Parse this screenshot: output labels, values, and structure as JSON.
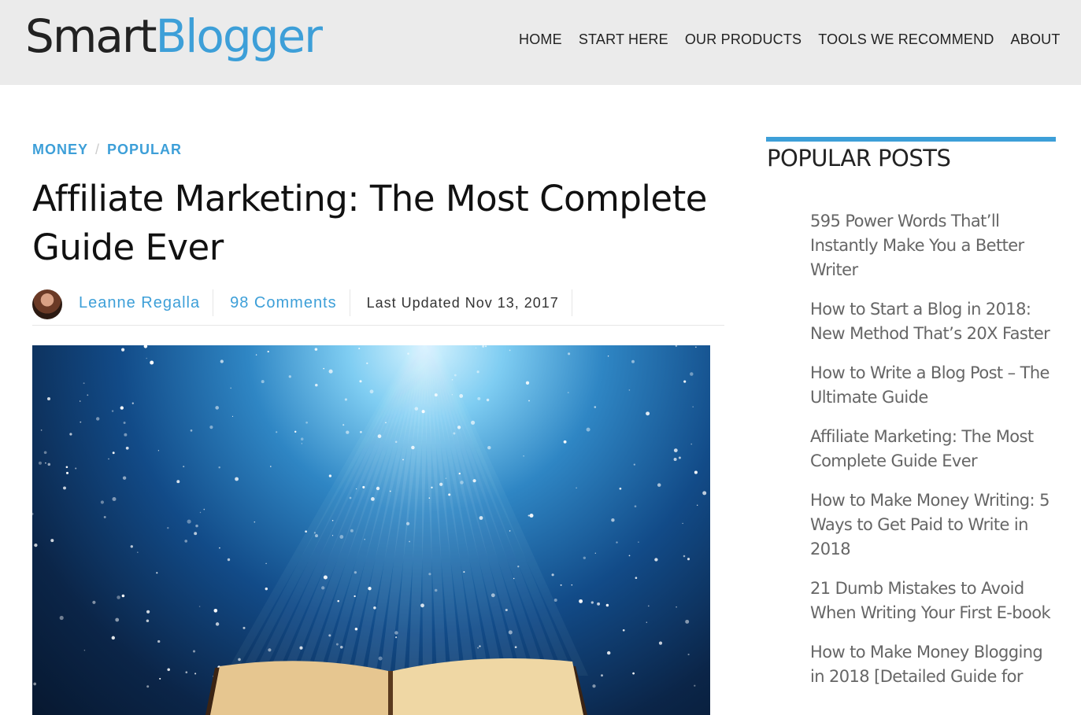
{
  "header": {
    "logo_part1": "Smart",
    "logo_part2": "Blogger",
    "nav": [
      "HOME",
      "START HERE",
      "OUR PRODUCTS",
      "TOOLS WE RECOMMEND",
      "ABOUT"
    ]
  },
  "article": {
    "categories": [
      "MONEY",
      "POPULAR"
    ],
    "title": "Affiliate Marketing: The Most Complete Guide Ever",
    "author": "Leanne Regalla",
    "comments": "98 Comments",
    "updated": "Last Updated Nov 13, 2017"
  },
  "sidebar": {
    "heading": "POPULAR POSTS",
    "posts": [
      "595 Power Words That’ll Instantly Make You a Better Writer",
      "How to Start a Blog in 2018: New Method That’s 20X Faster",
      "How to Write a Blog Post – The Ultimate Guide",
      "Affiliate Marketing: The Most Complete Guide Ever",
      "How to Make Money Writing: 5 Ways to Get Paid to Write in 2018",
      "21 Dumb Mistakes to Avoid When Writing Your First E-book",
      "How to Make Money Blogging in 2018 [Detailed Guide for"
    ]
  },
  "colors": {
    "accent": "#3d9fd8",
    "header_bg": "#ebebeb"
  }
}
